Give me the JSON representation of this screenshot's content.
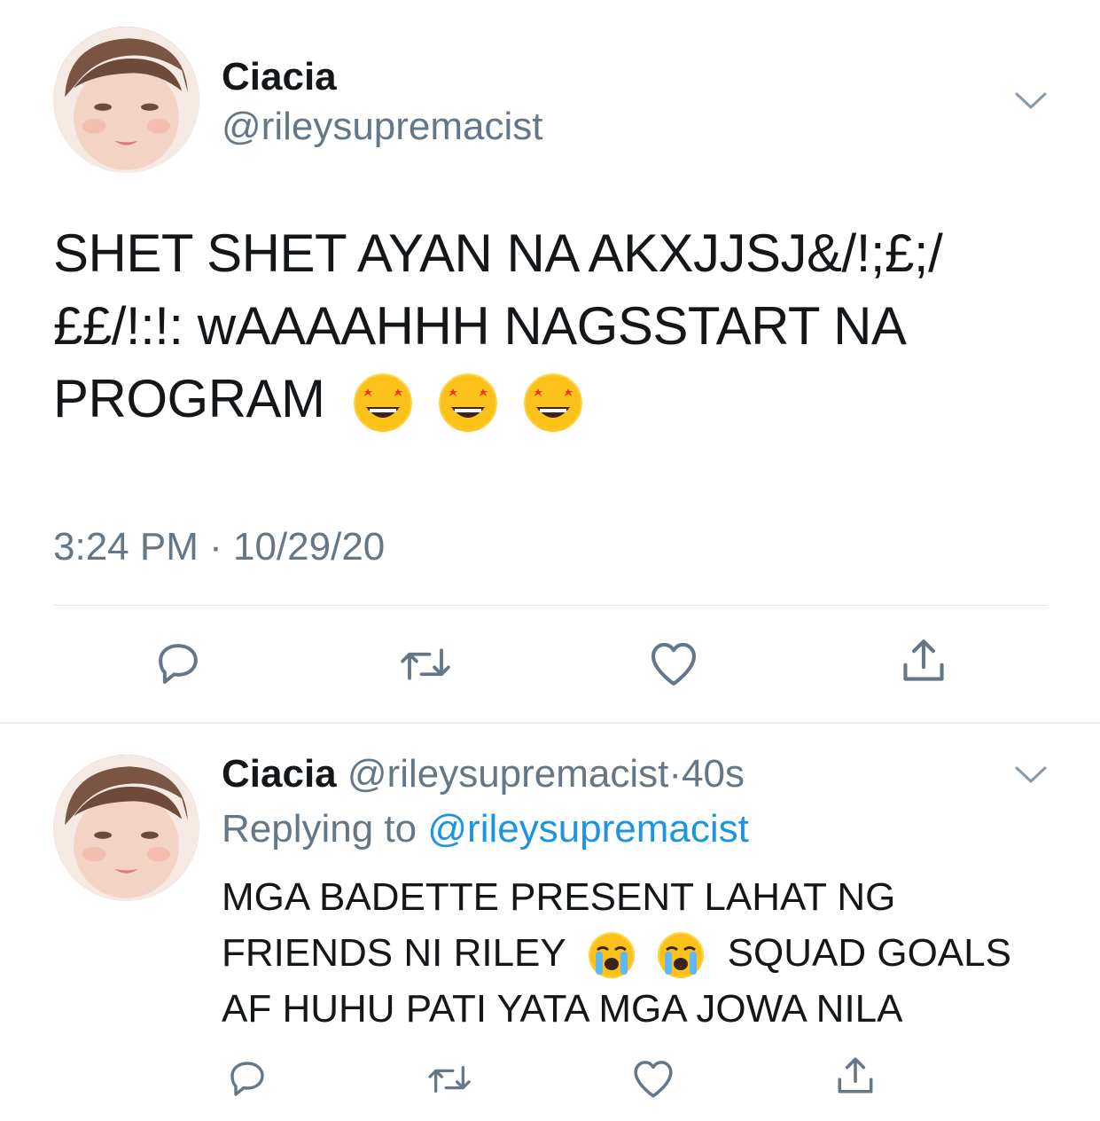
{
  "tweet": {
    "name": "Ciacia",
    "handle": "@rileysupremacist",
    "text_line1": "SHET SHET AYAN NA AKXJJSJ&/!;£;/",
    "text_line2": "££/!:!: wAAAAHHH NAGSSTART NA",
    "text_line3": "PROGRAM",
    "emoji": "star-struck",
    "time": "3:24 PM",
    "separator": "·",
    "date": "10/29/20"
  },
  "reply": {
    "name": "Ciacia",
    "handle": "@rileysupremacist",
    "separator": "·",
    "age": "40s",
    "replying_label": "Replying to",
    "replying_handle": "@rileysupremacist",
    "text_line1": "MGA BADETTE PRESENT LAHAT NG",
    "text_line2_a": "FRIENDS NI RILEY",
    "text_line2_b": "SQUAD GOALS",
    "text_line3": "AF HUHU PATI YATA MGA JOWA NILA",
    "emoji": "crying"
  },
  "colors": {
    "text": "#14171a",
    "secondary": "#657786",
    "link": "#1b95e0",
    "divider": "#e1e8ed"
  },
  "icons": [
    "reply-icon",
    "retweet-icon",
    "like-icon",
    "share-icon",
    "chevron-down-icon"
  ]
}
